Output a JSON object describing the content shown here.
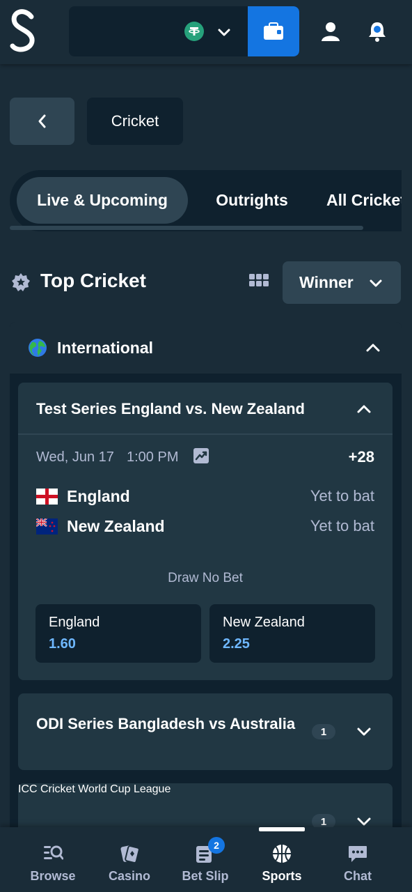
{
  "header": {
    "currency_icon": "tether-usdt-icon",
    "wallet_icon": "wallet-icon",
    "user_icon": "user-icon",
    "notification_icon": "bell-icon"
  },
  "breadcrumb": {
    "current": "Cricket"
  },
  "tabs": [
    {
      "label": "Live & Upcoming",
      "active": true
    },
    {
      "label": "Outrights",
      "active": false
    },
    {
      "label": "All Cricket",
      "active": false
    }
  ],
  "section": {
    "title": "Top Cricket",
    "market_dropdown": "Winner"
  },
  "region": {
    "name": "International",
    "expanded": true
  },
  "competitions": [
    {
      "name": "Test Series England vs. New Zealand",
      "expanded": true,
      "match": {
        "date": "Wed, Jun 17",
        "time": "1:00 PM",
        "more_markets": "+28",
        "teams": [
          {
            "name": "England",
            "status": "Yet to bat"
          },
          {
            "name": "New Zealand",
            "status": "Yet to bat"
          }
        ],
        "market_label": "Draw No Bet",
        "odds": [
          {
            "name": "England",
            "value": "1.60"
          },
          {
            "name": "New Zealand",
            "value": "2.25"
          }
        ]
      }
    },
    {
      "name": "ODI Series Bangladesh vs Australia",
      "count": "1",
      "expanded": false
    },
    {
      "name": "ICC Cricket World Cup League",
      "count": "1",
      "expanded": false
    }
  ],
  "bottom_nav": [
    {
      "label": "Browse",
      "icon": "browse-icon",
      "active": false
    },
    {
      "label": "Casino",
      "icon": "casino-cards-icon",
      "active": false
    },
    {
      "label": "Bet Slip",
      "icon": "bet-slip-icon",
      "active": false,
      "badge": "2"
    },
    {
      "label": "Sports",
      "icon": "basketball-icon",
      "active": true
    },
    {
      "label": "Chat",
      "icon": "chat-icon",
      "active": false
    }
  ],
  "colors": {
    "background": "#1a2c38",
    "dark": "#0f212e",
    "card": "#213743",
    "control": "#2f4553",
    "accent_blue": "#1475e1",
    "odds_blue": "#6fb8ff",
    "muted_text": "#b1bad3"
  }
}
